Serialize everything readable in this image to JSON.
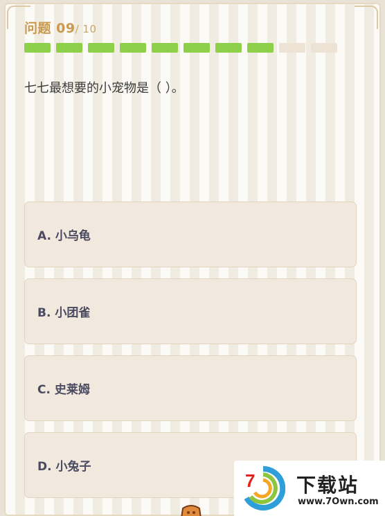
{
  "header": {
    "label": "问题",
    "current": "09",
    "total": "/ 10"
  },
  "progress": {
    "completed": 8,
    "total": 10,
    "done_color": "#8fd04a",
    "todo_color": "#ece3d5"
  },
  "question": {
    "text": "七七最想要的小宠物是（ ）。"
  },
  "options": [
    {
      "label": "A. 小乌龟"
    },
    {
      "label": "B. 小团雀"
    },
    {
      "label": "C. 史莱姆"
    },
    {
      "label": "D. 小兔子"
    }
  ],
  "watermark": {
    "logo_text": "7",
    "name": "下载站",
    "url": "www.7Own.com"
  },
  "colors": {
    "accent": "#c99a4e",
    "background": "#f7f3ec",
    "option_bg": "#f2e9de"
  }
}
